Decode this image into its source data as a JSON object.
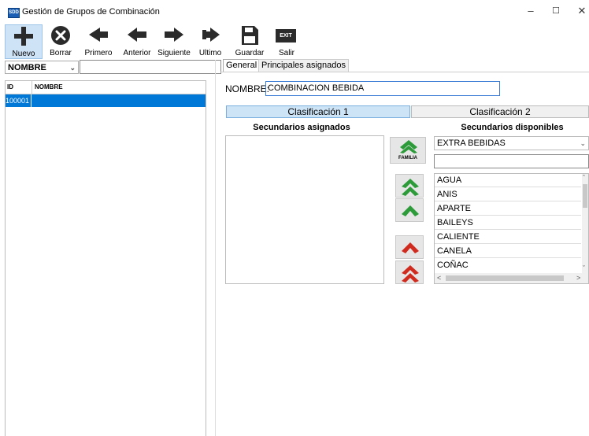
{
  "window": {
    "title": "Gestión de Grupos de Combinación",
    "icon_text": "SDD",
    "controls": {
      "minimize": "–",
      "maximize": "☐",
      "close": "✕"
    }
  },
  "toolbar": {
    "nuevo": "Nuevo",
    "borrar": "Borrar",
    "primero": "Primero",
    "anterior": "Anterior",
    "siguiente": "Siguiente",
    "ultimo": "Ultimo",
    "guardar": "Guardar",
    "salir": "Salir",
    "exit_icon_text": "EXIT"
  },
  "search": {
    "field_selected": "NOMBRE",
    "value": ""
  },
  "grid": {
    "columns": [
      "ID",
      "NOMBRE"
    ],
    "rows": [
      {
        "id": "100001",
        "nombre": ""
      }
    ]
  },
  "tabs": [
    {
      "label": "General",
      "active": true
    },
    {
      "label": "Principales asignados",
      "active": false
    }
  ],
  "form": {
    "nombre_label": "NOMBRE:",
    "nombre_value": "COMBINACION BEBIDA"
  },
  "classification_tabs": [
    {
      "label": "Clasificación 1",
      "active": true
    },
    {
      "label": "Clasificación 2",
      "active": false
    }
  ],
  "secundarios_asignados": {
    "title": "Secundarios asignados",
    "items": []
  },
  "familia_button": "FAMILIA",
  "secundarios_disponibles": {
    "title": "Secundarios disponibles",
    "family_selected": "EXTRA BEBIDAS",
    "filter_value": "",
    "items": [
      "AGUA",
      "ANIS",
      "APARTE",
      "BAILEYS",
      "CALIENTE",
      "CANELA",
      "COÑAC"
    ]
  },
  "colors": {
    "selection": "#0078d7",
    "arrow_green": "#2e9b3a",
    "arrow_red": "#d02b1f",
    "icon_dark": "#2b2b2b"
  }
}
